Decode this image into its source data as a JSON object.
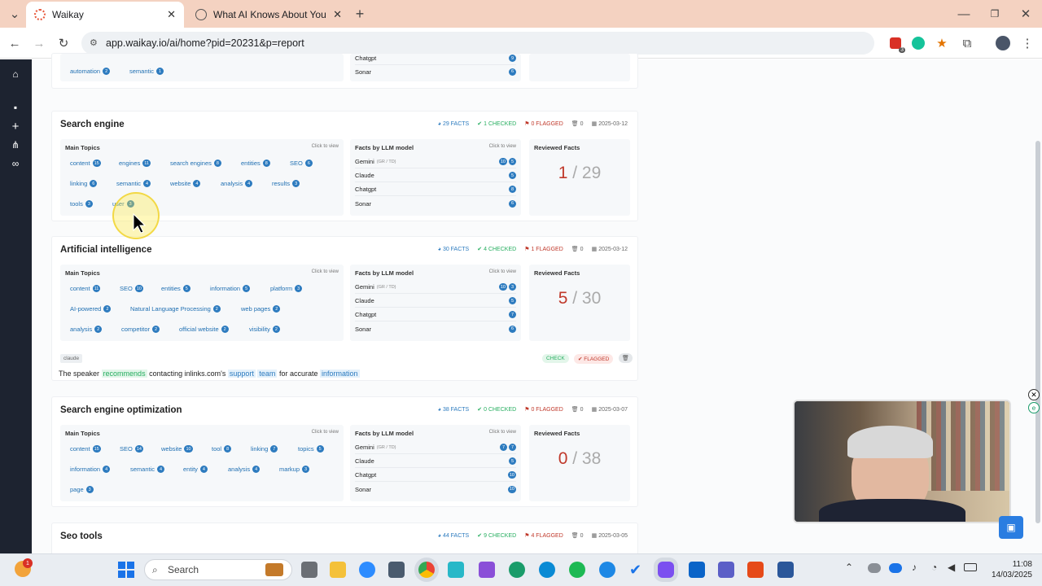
{
  "browser": {
    "tabs": [
      {
        "label": "Waikay",
        "active": true
      },
      {
        "label": "What AI Knows About You | Tak",
        "active": false
      }
    ],
    "url": "app.waikay.io/ai/home?pid=20231&p=report",
    "extension_badge": "3"
  },
  "top_partial": {
    "tags": [
      {
        "label": "automation",
        "count": "2"
      },
      {
        "label": "semantic",
        "count": "1"
      }
    ],
    "llms": [
      {
        "name": "Chatgpt",
        "count": "9"
      },
      {
        "name": "Sonar",
        "count": "6"
      }
    ]
  },
  "labels": {
    "main_topics": "Main Topics",
    "facts_by_llm": "Facts by LLM model",
    "reviewed_facts": "Reviewed Facts",
    "click_to_view": "Click to view",
    "sep": "/"
  },
  "cards": [
    {
      "title": "Search engine",
      "facts": "29 FACTS",
      "checked": "1 CHECKED",
      "flagged": "0 FLAGGED",
      "deleted": "0",
      "date": "2025-03-12",
      "topics": [
        {
          "label": "content",
          "count": "15"
        },
        {
          "label": "engines",
          "count": "11"
        },
        {
          "label": "search engines",
          "count": "8"
        },
        {
          "label": "entities",
          "count": "8"
        },
        {
          "label": "SEO",
          "count": "6"
        },
        {
          "label": "linking",
          "count": "6"
        },
        {
          "label": "semantic",
          "count": "4"
        },
        {
          "label": "website",
          "count": "4"
        },
        {
          "label": "analysis",
          "count": "4"
        },
        {
          "label": "results",
          "count": "3"
        },
        {
          "label": "tools",
          "count": "3"
        },
        {
          "label": "user",
          "count": "3"
        }
      ],
      "llms": [
        {
          "name": "Gemini",
          "sub": "(GR / TD)",
          "counts": [
            "10",
            "5"
          ]
        },
        {
          "name": "Claude",
          "sub": "",
          "counts": [
            "5"
          ]
        },
        {
          "name": "Chatgpt",
          "sub": "",
          "counts": [
            "8"
          ]
        },
        {
          "name": "Sonar",
          "sub": "",
          "counts": [
            "6"
          ]
        }
      ],
      "reviewed": "1",
      "total": "29"
    },
    {
      "title": "Artificial intelligence",
      "facts": "30 FACTS",
      "checked": "4 CHECKED",
      "flagged": "1 FLAGGED",
      "deleted": "0",
      "date": "2025-03-12",
      "topics": [
        {
          "label": "content",
          "count": "11"
        },
        {
          "label": "SEO",
          "count": "10"
        },
        {
          "label": "entities",
          "count": "5"
        },
        {
          "label": "information",
          "count": "5"
        },
        {
          "label": "platform",
          "count": "3"
        },
        {
          "label": "AI-powered",
          "count": "2"
        },
        {
          "label": "Natural Language Processing",
          "count": "2"
        },
        {
          "label": "web pages",
          "count": "2"
        },
        {
          "label": "analysis",
          "count": "2"
        },
        {
          "label": "competitor",
          "count": "2"
        },
        {
          "label": "official website",
          "count": "2"
        },
        {
          "label": "visibility",
          "count": "2"
        }
      ],
      "llms": [
        {
          "name": "Gemini",
          "sub": "(GR / TD)",
          "counts": [
            "10",
            "3"
          ]
        },
        {
          "name": "Claude",
          "sub": "",
          "counts": [
            "5"
          ]
        },
        {
          "name": "Chatgpt",
          "sub": "",
          "counts": [
            "7"
          ]
        },
        {
          "name": "Sonar",
          "sub": "",
          "counts": [
            "6"
          ]
        }
      ],
      "reviewed": "5",
      "total": "30",
      "fact": {
        "model": "claude",
        "check_label": "CHECK",
        "flagged_label": "FLAGGED",
        "parts": [
          "The speaker",
          "recommends",
          "contacting inlinks.com's",
          "support",
          "team",
          "for accurate",
          "information"
        ]
      }
    },
    {
      "title": "Search engine optimization",
      "facts": "38 FACTS",
      "checked": "0 CHECKED",
      "flagged": "0 FLAGGED",
      "deleted": "0",
      "date": "2025-03-07",
      "topics": [
        {
          "label": "content",
          "count": "15"
        },
        {
          "label": "SEO",
          "count": "14"
        },
        {
          "label": "website",
          "count": "10"
        },
        {
          "label": "tool",
          "count": "8"
        },
        {
          "label": "linking",
          "count": "7"
        },
        {
          "label": "topics",
          "count": "5"
        },
        {
          "label": "information",
          "count": "4"
        },
        {
          "label": "semantic",
          "count": "4"
        },
        {
          "label": "entity",
          "count": "4"
        },
        {
          "label": "analysis",
          "count": "4"
        },
        {
          "label": "markup",
          "count": "3"
        },
        {
          "label": "page",
          "count": "3"
        }
      ],
      "llms": [
        {
          "name": "Gemini",
          "sub": "(GR / TD)",
          "counts": [
            "7",
            "7"
          ]
        },
        {
          "name": "Claude",
          "sub": "",
          "counts": [
            "5"
          ]
        },
        {
          "name": "Chatgpt",
          "sub": "",
          "counts": [
            "10"
          ]
        },
        {
          "name": "Sonar",
          "sub": "",
          "counts": [
            "10"
          ]
        }
      ],
      "reviewed": "0",
      "total": "38"
    },
    {
      "title": "Seo tools",
      "facts": "44 FACTS",
      "checked": "9 CHECKED",
      "flagged": "4 FLAGGED",
      "deleted": "0",
      "date": "2025-03-05"
    }
  ],
  "taskbar": {
    "search_placeholder": "Search",
    "time": "11:08",
    "date": "14/03/2025",
    "notification_count": "1"
  }
}
